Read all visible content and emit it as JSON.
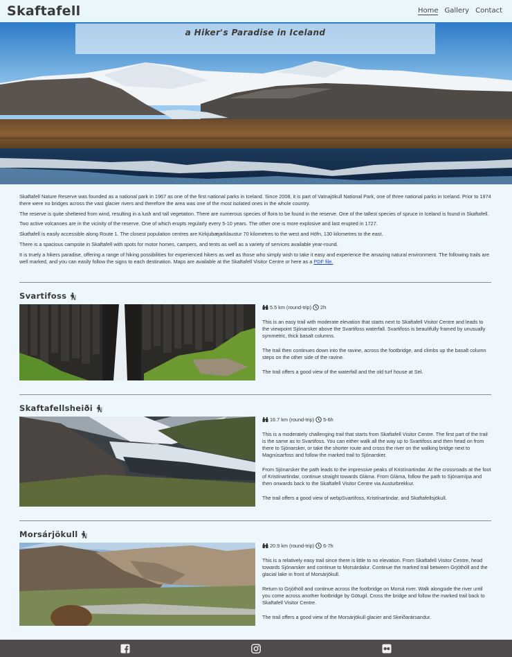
{
  "header": {
    "logo": "Skaftafell",
    "nav": [
      {
        "label": "Home",
        "active": true
      },
      {
        "label": "Gallery",
        "active": false
      },
      {
        "label": "Contact",
        "active": false
      }
    ]
  },
  "hero": {
    "tagline": "a Hiker's Paradise in Iceland"
  },
  "intro": {
    "paragraphs": [
      "Skaftafell Nature Reserve was founded as a national park in 1967 as one of the first national parks in Iceland. Since 2008, it is part of Vatnajökull National Park, one of three national parks in Iceland. Prior to 1974 there were no bridges across the vast glacier rivers and therefore the area was one of the most isolated ones in the whole country.",
      "The reserve is quite sheltered from wind, resulting in a lush and tall vegetation. There are numerous species of flora to be found in the reserve. One of the tallest species of spruce in Iceland is found in Skaftafell.",
      "Two active volcanoes are in the vicinity of the reserve. One of which erupts regularly every 5-10 years. The other one is more explosive and last erupted in 1727.",
      "Skaftafell is easily accessible along Route 1. The closest population centres are Kirkjubæjarklaustur 70 kilometres to the west and Höfn, 130 kilometres to the east.",
      "There is a spacious campsite in Skaftafell with spots for motor homes, campers, and tents as well as a variety of services available year-round."
    ],
    "last_paragraph_text": "It is truely a hikers paradise, offering a range of hiking possibilities for experienced hikers as well as those who simply wish to take it easy and experience the amazing natural environment. The following trails are well marked, and you can easily follow the signs to each destination. Maps are available at the Skaftafell Visitor Centre or here as a ",
    "pdf_link": "PDF file."
  },
  "trails": [
    {
      "name": "Svartifoss",
      "distance": "5.5 km (round-trip)",
      "duration": "2h",
      "paragraphs": [
        "This is an easy trail with moderate elevation that starts next to Skaftafell Visitor Centre and leads to the viewpoint Sjónarsker above the Svartifoss waterfall. Svartifoss is beautifully framed by unusually symmetric, thick basalt columns.",
        "The trail then continues down into the ravine, across the footbridge, and climbs up the basalt column steps on the other side of the ravine.",
        "The trail offers a good view of the waterfall and the old turf house at Sel."
      ]
    },
    {
      "name": "Skaftafellsheiði",
      "distance": "16.7 km (round-trip)",
      "duration": "5-6h",
      "paragraphs": [
        "This is a moderately challenging trail that starts from Skaftafell Visitor Centre. The first part of the trail is the same as to Svartifoss. You can either walk all the way up to Svartifoss and then head on from there to Sjónarsker, or take the shorter route and cross the river on the walking bridge next to Magnúsarfoss and follow the marked trail to Sjónarsker.",
        "From Sjónarsker the path leads to the impressive peaks of Kristínartindar. At the crossroads at the foot of Kristínartindar, continue straight towards Gláma. From Gláma, follow the path to Sjónarnípa and then onwards back to the Skaftafell Visitor Centre via Austurbrekkur.",
        "The trail offers a good view of webpSvartifoss, Kristínartindar, and Skaftafellsjökull."
      ]
    },
    {
      "name": "Morsárjökull",
      "distance": "20.9 km (round-trip)",
      "duration": "6-7h",
      "paragraphs": [
        "This is a relatively easy trail since there is little to no elevation. From Skaftafell Visitor Centre, head towards Sjónarsker and continue to Morsárdalur. Continue the marked trail between Grjóthóll and the glacial lake in front of Morsárjökull.",
        "Return to Grjóthóll and continue across the footbridge on Morsá river. Walk alongside the river until you come across another footbridge by Götugil. Cross the bridge and follow the marked trail back to Skaftafell Visitor Centre.",
        "The trail offers a good view of the Morsárjökull glacier and Skeiðarársandur."
      ]
    }
  ],
  "icons": {
    "hiker": "hiking-icon",
    "binoculars": "binoculars-icon",
    "clock": "clock-icon"
  },
  "footer": {
    "social": [
      "facebook-icon",
      "instagram-icon",
      "flickr-icon"
    ]
  },
  "colors": {
    "background": "#eef7fb",
    "footer": "#514a4a",
    "link": "#1f3fcf"
  }
}
